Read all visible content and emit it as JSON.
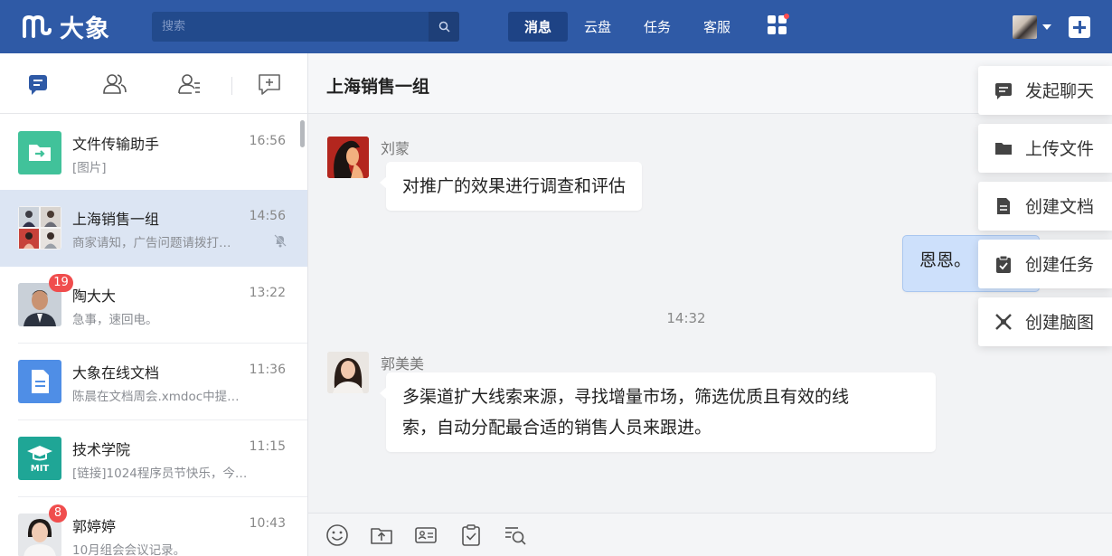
{
  "app": {
    "brand_name": "大象",
    "brand_color": "#2f5aa6"
  },
  "search": {
    "placeholder": "搜索"
  },
  "nav": {
    "tabs": [
      {
        "label": "消息",
        "active": true
      },
      {
        "label": "云盘"
      },
      {
        "label": "任务"
      },
      {
        "label": "客服"
      }
    ]
  },
  "sidebar": {
    "tabs": [
      {
        "icon": "chat-icon",
        "active": true
      },
      {
        "icon": "contacts-icon"
      },
      {
        "icon": "org-icon"
      },
      {
        "icon": "new-chat-icon"
      }
    ],
    "conversations": [
      {
        "name": "文件传输助手",
        "time": "16:56",
        "preview": "[图片]",
        "avatar": "file-transfer-icon"
      },
      {
        "name": "上海销售一组",
        "time": "14:56",
        "preview": "商家请知，广告问题请拨打…",
        "selected": true,
        "muted": true,
        "avatar": "group-avatar"
      },
      {
        "name": "陶大大",
        "time": "13:22",
        "preview": "急事，速回电。",
        "badge": "19",
        "avatar": "person-avatar"
      },
      {
        "name": "大象在线文档",
        "time": "11:36",
        "preview": "陈晨在文档周会.xmdoc中提…",
        "avatar": "document-icon"
      },
      {
        "name": "技术学院",
        "time": "11:15",
        "preview": "[链接]1024程序员节快乐，今…",
        "avatar": "mit-logo",
        "avatar_text": "MIT"
      },
      {
        "name": "郭婷婷",
        "time": "10:43",
        "preview": "10月组会会议记录。",
        "badge": "8",
        "avatar": "person-avatar"
      }
    ]
  },
  "chat": {
    "title": "上海销售一组",
    "messages": [
      {
        "sender": "刘蒙",
        "text": "对推广的效果进行调查和评估"
      },
      {
        "sender": "",
        "text": "恩恩。",
        "mine": true
      },
      {
        "sender": "郭美美",
        "text_line1": "多渠道扩大线索来源，寻找增量市场，筛选优质且有效的线",
        "text_line2": "索，自动分配最合适的销售人员来跟进。"
      }
    ],
    "timestamp": "14:32"
  },
  "menu": {
    "items": [
      {
        "label": "发起聊天",
        "icon": "chat-icon"
      },
      {
        "label": "上传文件",
        "icon": "folder-icon"
      },
      {
        "label": "创建文档",
        "icon": "document-icon"
      },
      {
        "label": "创建任务",
        "icon": "task-icon"
      },
      {
        "label": "创建脑图",
        "icon": "mindmap-icon"
      }
    ]
  }
}
